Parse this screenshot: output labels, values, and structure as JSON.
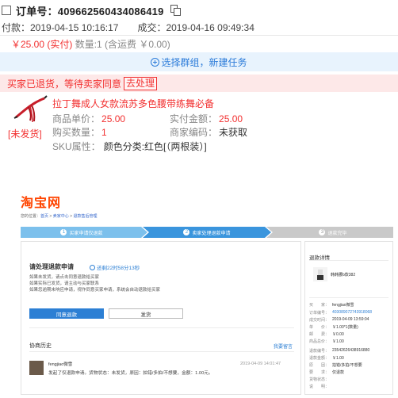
{
  "order": {
    "order_no_label": "订单号：409662560434086419",
    "pay_time": "付款：2019-04-15 10:16:17",
    "deal_time": "成交：2019-04-16 09:49:34",
    "amount": "￥25.00 (实付)",
    "quantity": "数量:1 (含运费 ￥0.00)",
    "group_task": "选择群组，新建任务",
    "refund_status": "买家已退货，等待卖家同意",
    "handle_button": "去处理",
    "shipping_status": "[未发货]",
    "product_title": "拉丁舞成人女款流苏多色腰带练舞必备",
    "unit_price_label": "商品单价：",
    "unit_price": "25.00",
    "paid_label": "实付金额：",
    "paid": "25.00",
    "buy_qty_label": "购买数量：",
    "buy_qty": "1",
    "merchant_code_label": "商家编码：",
    "merchant_code": "未获取",
    "sku_label": "SKU属性：",
    "sku": "颜色分类:红色[（两根装）]"
  },
  "taobao": {
    "logo": "淘宝网",
    "breadcrumb": {
      "prefix": "您的位置：",
      "home": "首页",
      "seller_center": "卖家中心",
      "refund_mgmt": "退款售后管理"
    },
    "steps": [
      {
        "num": "1",
        "label": "买家申请仅退款"
      },
      {
        "num": "2",
        "label": "卖家处理退款申请"
      },
      {
        "num": "3",
        "label": "退款完毕"
      }
    ],
    "request_title": "请处理退款申请",
    "countdown": "还剩22时58分13秒",
    "notes": [
      "如果未发货，请点击同意退款给买家",
      "如果实际已发货，请主动与买家联系",
      "如果您逾期未响应申请，视作同意买家申请，系统会自动退款给买家"
    ],
    "agree_button": "同意退款",
    "ship_button": "发货",
    "history_title": "协商历史",
    "history_link": "我要留言",
    "history_user": "fengjiao微雪",
    "history_time": "2019-04-09 14:01:47",
    "history_msg": "发起了仅退款申请。货物状态：未发货，原因：拍错/多拍/不想要，金额：1.00元。",
    "detail_title": "退款详情",
    "detail_product": "韩韩腰b款382",
    "detail_rows": [
      {
        "label": "买　　家：",
        "value": "fengjiao微雪"
      },
      {
        "label": "订单编号：",
        "value": "403089072743918068"
      },
      {
        "label": "成交时间：",
        "value": "2019-04-09 13:59:04"
      },
      {
        "label": "单　　价：",
        "value": "￥1.00*1(数量)"
      },
      {
        "label": "邮　　费：",
        "value": "￥0.00"
      },
      {
        "label": "商品总价：",
        "value": "￥1.00"
      },
      {
        "label": "退款编号：",
        "value": "23542626438916880"
      },
      {
        "label": "退款金额：",
        "value": "￥1.00"
      },
      {
        "label": "原　　因：",
        "value": "拍错/多拍/不想要"
      },
      {
        "label": "要　　求：",
        "value": "仅退款"
      },
      {
        "label": "货物状态：",
        "value": ""
      },
      {
        "label": "说　　明：",
        "value": ""
      }
    ]
  },
  "colors": {
    "accent_red": "#f23030",
    "link_blue": "#2b7bd9",
    "taobao_orange": "#ff4400",
    "step_blue": "#4aa3df"
  }
}
